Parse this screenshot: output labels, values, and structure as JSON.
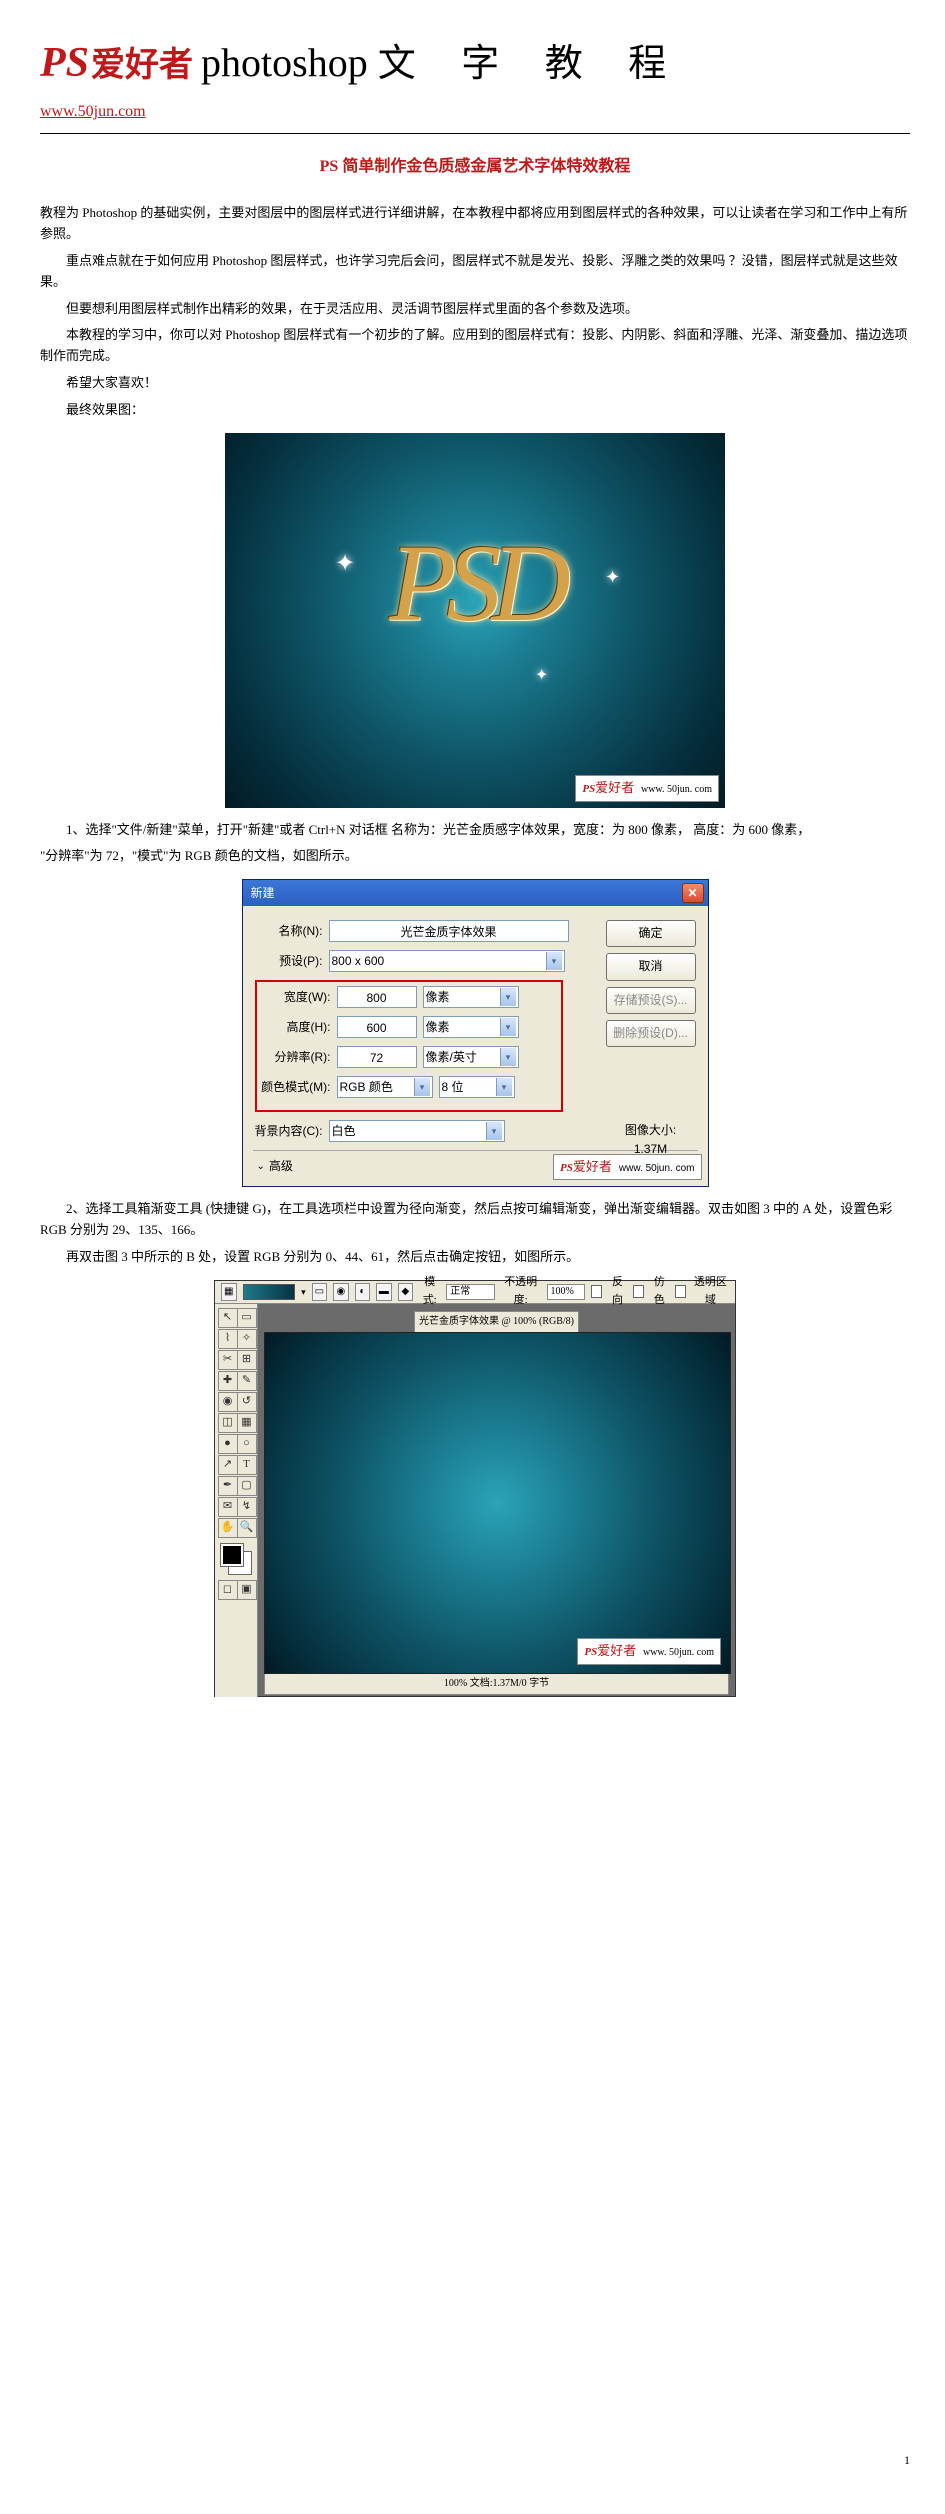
{
  "header": {
    "ps": "PS",
    "fan": "爱好者",
    "photoshop": "photoshop",
    "tutorial": "文 字 教 程",
    "url": "www.50jun.com"
  },
  "title": "PS 简单制作金色质感金属艺术字体特效教程",
  "paragraphs": {
    "p1": "教程为 Photoshop 的基础实例，主要对图层中的图层样式进行详细讲解，在本教程中都将应用到图层样式的各种效果，可以让读者在学习和工作中上有所参照。",
    "p2": "重点难点就在于如何应用 Photoshop 图层样式，也许学习完后会问，图层样式不就是发光、投影、浮雕之类的效果吗 ？没错，图层样式就是这些效果。",
    "p3": "但要想利用图层样式制作出精彩的效果，在于灵活应用、灵活调节图层样式里面的各个参数及选项。",
    "p4": "本教程的学习中，你可以对 Photoshop 图层样式有一个初步的了解。应用到的图层样式有：投影、内阴影、斜面和浮雕、光泽、渐变叠加、描边选项制作而完成。",
    "p5": "希望大家喜欢！",
    "p6": "最终效果图：",
    "step1a": "1、选择\"文件/新建\"菜单，打开\"新建\"或者 Ctrl+N 对话框 名称为：光芒金质感字体效果，宽度：为 800 像素， 高度：为 600 像素，",
    "step1b": "\"分辨率\"为 72，\"模式\"为 RGB 颜色的文档，如图所示。",
    "step2a": "2、选择工具箱渐变工具 (快捷键 G)，在工具选项栏中设置为径向渐变，然后点按可编辑渐变，弹出渐变编辑器。双击如图 3 中的 A 处，设置色彩 RGB 分别为 29、135、166。",
    "step2b": "再双击图 3 中所示的 B 处，设置 RGB 分别为 0、44、61，然后点击确定按钮，如图所示。"
  },
  "fig1": {
    "text": "PSD",
    "badge_ps": "PS",
    "badge_txt": "爱好者",
    "badge_url": "www. 50jun. com"
  },
  "fig2": {
    "titlebar": "新建",
    "name_label": "名称(N):",
    "name_value": "光芒金质字体效果",
    "preset_label": "预设(P):",
    "preset_value": "800 x 600",
    "width_label": "宽度(W):",
    "width_value": "800",
    "width_unit": "像素",
    "height_label": "高度(H):",
    "height_value": "600",
    "height_unit": "像素",
    "res_label": "分辨率(R):",
    "res_value": "72",
    "res_unit": "像素/英寸",
    "mode_label": "颜色模式(M):",
    "mode_value": "RGB 颜色",
    "mode_bits": "8 位",
    "bg_label": "背景内容(C):",
    "bg_value": "白色",
    "btn_ok": "确定",
    "btn_cancel": "取消",
    "btn_save": "存储预设(S)...",
    "btn_delete": "删除预设(D)...",
    "size_label": "图像大小:",
    "size_value": "1.37M",
    "advanced": "高级",
    "badge_ps": "PS",
    "badge_txt": "爱好者",
    "badge_url": "www. 50jun. com"
  },
  "fig3": {
    "mode_label": "模式:",
    "mode_value": "正常",
    "opacity_label": "不透明度:",
    "opacity_value": "100%",
    "reverse": "反向",
    "dither": "仿色",
    "transparency": "透明区域",
    "doc_title": "光芒金质字体效果 @ 100% (RGB/8)",
    "status": "100%    文档:1.37M/0 字节",
    "badge_ps": "PS",
    "badge_txt": "爱好者",
    "badge_url": "www. 50jun. com"
  },
  "page_number": "1"
}
